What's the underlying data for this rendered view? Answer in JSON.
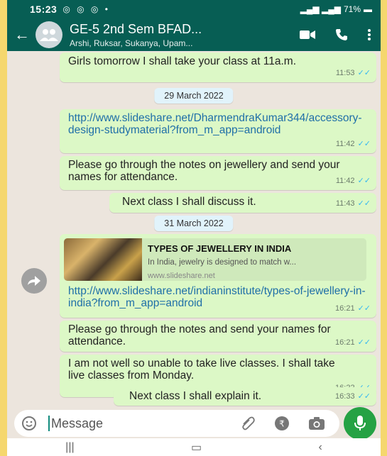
{
  "status": {
    "time": "15:23",
    "battery": "71%"
  },
  "header": {
    "title": "GE-5 2nd Sem BFAD...",
    "subtitle": "Arshi, Ruksar, Sukanya, Upam..."
  },
  "messages": [
    {
      "text": "Girls tomorrow I shall take your class at 11a.m.",
      "time": "11:53"
    },
    {
      "text": "http://www.slideshare.net/DharmendraKumar344/accessory-design-studymaterial?from_m_app=android",
      "time": "11:42"
    },
    {
      "text": "Please go through the notes on jewellery and send your names for attendance.",
      "time": "11:42"
    },
    {
      "text": "Next class I shall discuss it.",
      "time": "11:43"
    },
    {
      "text": "http://www.slideshare.net/indianinstitute/types-of-jewellery-in-india?from_m_app=android",
      "time": "16:21"
    },
    {
      "text": "Please go through the notes and send your names for attendance.",
      "time": "16:21"
    },
    {
      "text": "I am not well so unable to take live classes. I shall take live classes from Monday.",
      "time": "16:22"
    },
    {
      "text": "Next class I shall explain it.",
      "time": "16:33"
    }
  ],
  "dates": [
    "29 March 2022",
    "31 March 2022"
  ],
  "preview": {
    "title": "TYPES OF JEWELLERY IN INDIA",
    "desc": "In India, jewelry is designed to match w...",
    "url": "www.slideshare.net"
  },
  "input": {
    "placeholder": "Message"
  },
  "colors": {
    "header": "#075e54",
    "bubble": "#dcf8c6",
    "tick": "#34b7f1",
    "mic": "#25a244"
  }
}
